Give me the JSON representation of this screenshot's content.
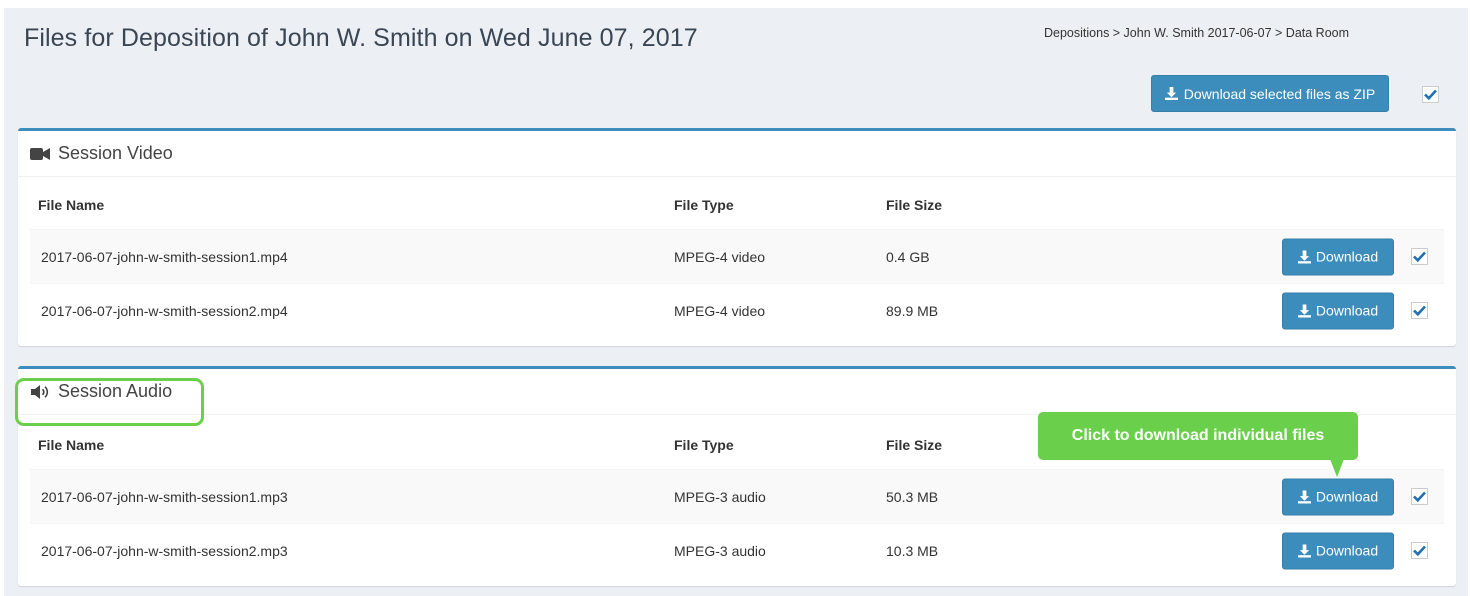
{
  "page": {
    "title": "Files for Deposition of John W. Smith on Wed June 07, 2017",
    "breadcrumb": "Depositions > John W. Smith 2017-06-07 > Data Room"
  },
  "toolbar": {
    "zip_label": "Download selected files as ZIP",
    "select_all_checked": true
  },
  "columns": {
    "file_name": "File Name",
    "file_type": "File Type",
    "file_size": "File Size"
  },
  "sections": [
    {
      "title": "Session Video",
      "icon": "video-camera-icon",
      "files": [
        {
          "name": "2017-06-07-john-w-smith-session1.mp4",
          "type": "MPEG-4 video",
          "size": "0.4 GB",
          "download_label": "Download",
          "checked": true
        },
        {
          "name": "2017-06-07-john-w-smith-session2.mp4",
          "type": "MPEG-4 video",
          "size": "89.9 MB",
          "download_label": "Download",
          "checked": true
        }
      ]
    },
    {
      "title": "Session Audio",
      "icon": "speaker-icon",
      "files": [
        {
          "name": "2017-06-07-john-w-smith-session1.mp3",
          "type": "MPEG-3 audio",
          "size": "50.3 MB",
          "download_label": "Download",
          "checked": true
        },
        {
          "name": "2017-06-07-john-w-smith-session2.mp3",
          "type": "MPEG-3 audio",
          "size": "10.3 MB",
          "download_label": "Download",
          "checked": true
        }
      ]
    }
  ],
  "callout": {
    "text": "Click to download individual files"
  },
  "colors": {
    "primary": "#3c8dbc",
    "callout": "#6ad04b",
    "background": "#ecf0f5"
  }
}
